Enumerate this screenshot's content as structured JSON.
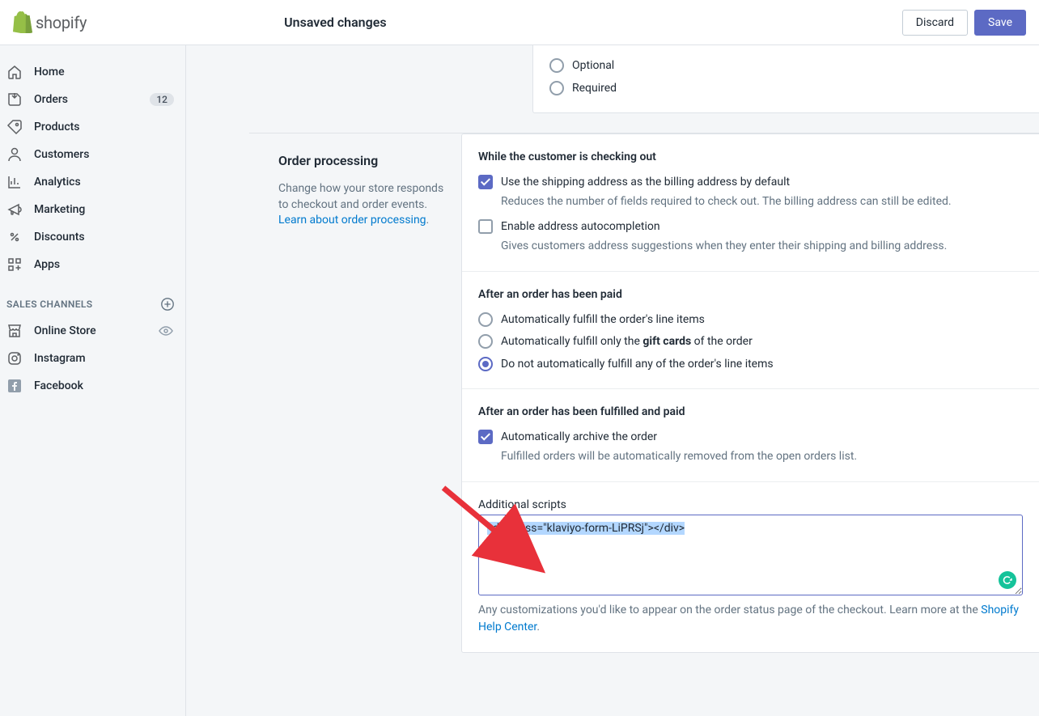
{
  "topbar": {
    "logo_text": "shopify",
    "unsaved": "Unsaved changes",
    "discard": "Discard",
    "save": "Save"
  },
  "sidebar": {
    "items": [
      {
        "label": "Home"
      },
      {
        "label": "Orders",
        "badge": "12"
      },
      {
        "label": "Products"
      },
      {
        "label": "Customers"
      },
      {
        "label": "Analytics"
      },
      {
        "label": "Marketing"
      },
      {
        "label": "Discounts"
      },
      {
        "label": "Apps"
      }
    ],
    "channels_heading": "SALES CHANNELS",
    "channels": [
      {
        "label": "Online Store"
      },
      {
        "label": "Instagram"
      },
      {
        "label": "Facebook"
      }
    ]
  },
  "partial": {
    "optional": "Optional",
    "required": "Required"
  },
  "order_processing": {
    "title": "Order processing",
    "desc_pre": "Change how your store responds to checkout and order events. ",
    "desc_link": "Learn about order processing",
    "desc_post": ".",
    "checkout": {
      "title": "While the customer is checking out",
      "opt1_label": "Use the shipping address as the billing address by default",
      "opt1_help": "Reduces the number of fields required to check out. The billing address can still be edited.",
      "opt2_label": "Enable address autocompletion",
      "opt2_help": "Gives customers address suggestions when they enter their shipping and billing address."
    },
    "paid": {
      "title": "After an order has been paid",
      "r1": "Automatically fulfill the order's line items",
      "r2_pre": "Automatically fulfill only the ",
      "r2_bold": "gift cards",
      "r2_post": " of the order",
      "r3": "Do not automatically fulfill any of the order's line items"
    },
    "fulfilled": {
      "title": "After an order has been fulfilled and paid",
      "c1_label": "Automatically archive the order",
      "c1_help": "Fulfilled orders will be automatically removed from the open orders list."
    },
    "scripts": {
      "label": "Additional scripts",
      "value": "<div class=\"klaviyo-form-LiPRSj\"></div>",
      "help_pre": "Any customizations you'd like to appear on the order status page of the checkout. Learn more at the ",
      "help_link": "Shopify Help Center",
      "help_post": "."
    }
  }
}
